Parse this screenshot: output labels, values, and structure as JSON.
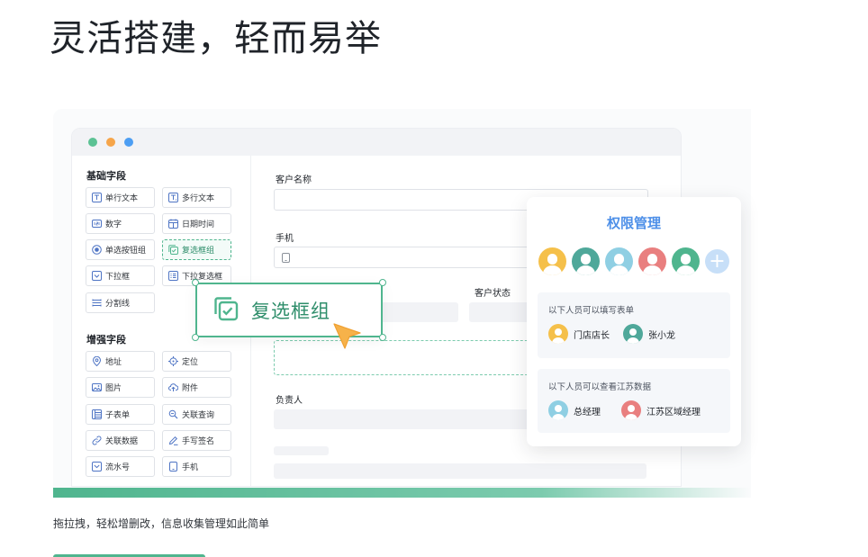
{
  "headline": "灵活搭建，轻而易举",
  "colors": {
    "accent_green": "#4fb58e",
    "accent_blue": "#4d8fe8",
    "dot_green": "#5cc294",
    "dot_orange": "#f6a54a",
    "dot_blue": "#4d9ef3"
  },
  "palette": {
    "basic_title": "基础字段",
    "basic_fields": [
      {
        "label": "单行文本",
        "icon": "text-single-icon"
      },
      {
        "label": "多行文本",
        "icon": "text-multi-icon"
      },
      {
        "label": "数字",
        "icon": "number-icon"
      },
      {
        "label": "日期时间",
        "icon": "calendar-icon"
      },
      {
        "label": "单选按钮组",
        "icon": "radio-icon"
      },
      {
        "label": "复选框组",
        "icon": "checkbox-icon"
      },
      {
        "label": "下拉框",
        "icon": "dropdown-icon"
      },
      {
        "label": "下拉复选框",
        "icon": "dropdown-multi-icon"
      },
      {
        "label": "分割线",
        "icon": "divider-icon"
      }
    ],
    "advanced_title": "增强字段",
    "advanced_fields": [
      {
        "label": "地址",
        "icon": "location-pin-icon"
      },
      {
        "label": "定位",
        "icon": "crosshair-icon"
      },
      {
        "label": "图片",
        "icon": "image-icon"
      },
      {
        "label": "附件",
        "icon": "upload-cloud-icon"
      },
      {
        "label": "子表单",
        "icon": "subform-icon"
      },
      {
        "label": "关联查询",
        "icon": "link-search-icon"
      },
      {
        "label": "关联数据",
        "icon": "link-data-icon"
      },
      {
        "label": "手写签名",
        "icon": "pen-icon"
      },
      {
        "label": "流水号",
        "icon": "serial-icon"
      },
      {
        "label": "手机",
        "icon": "phone-icon"
      }
    ]
  },
  "form": {
    "customer_name_label": "客户名称",
    "phone_label": "手机",
    "customer_status_label": "客户状态",
    "owner_label": "负责人"
  },
  "drag_card": {
    "label": "复选框组",
    "icon": "checkbox-icon"
  },
  "permission": {
    "title": "权限管理",
    "avatars": [
      "#f5c04a",
      "#4fa89a",
      "#8fcfe3",
      "#e97f7f",
      "#4fb58e"
    ],
    "write_caption": "以下人员可以填写表单",
    "write_people": [
      {
        "name": "门店店长",
        "color": "#f5c04a"
      },
      {
        "name": "张小龙",
        "color": "#4fa89a"
      }
    ],
    "view_caption": "以下人员可以查看江苏数据",
    "view_people": [
      {
        "name": "总经理",
        "color": "#8fcfe3"
      },
      {
        "name": "江苏区域经理",
        "color": "#e97f7f"
      }
    ]
  },
  "caption": "拖拉拽，轻松增删改，信息收集管理如此简单"
}
